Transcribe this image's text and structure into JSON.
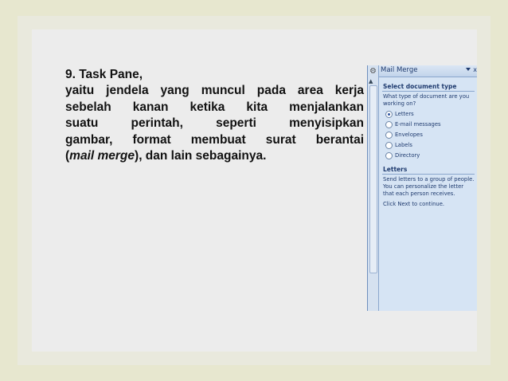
{
  "slide": {
    "title": "9.  Task Pane,",
    "lines": [
      "yaitu jendela yang muncul pada area kerja",
      "sebelah kanan ketika kita menjalankan",
      "suatu perintah, seperti menyisipkan",
      "gambar, format membuat surat berantai"
    ],
    "last_open": "(",
    "last_italic": "mail merge",
    "last_rest": "), dan lain sebagainya."
  },
  "task_pane": {
    "title": "Mail Merge",
    "close_label": "x",
    "section1_title": "Select document type",
    "question_line1": "What type of document are you",
    "question_line2": "working on?",
    "options": [
      "Letters",
      "E-mail messages",
      "Envelopes",
      "Labels",
      "Directory"
    ],
    "selected_option": "Letters",
    "section2_title": "Letters",
    "desc_line1": "Send letters to a group of people.",
    "desc_line2": "You can personalize the letter",
    "desc_line3": "that each person receives.",
    "next_hint": "Click Next to continue."
  },
  "colors": {
    "slide_bg": "#ececec",
    "pane_bg": "#d6e4f4",
    "pane_text": "#1e3a6e"
  },
  "icons": [
    "gear-icon",
    "scroll-up-icon",
    "dropdown-arrow-icon",
    "close-icon",
    "radio-icon"
  ]
}
